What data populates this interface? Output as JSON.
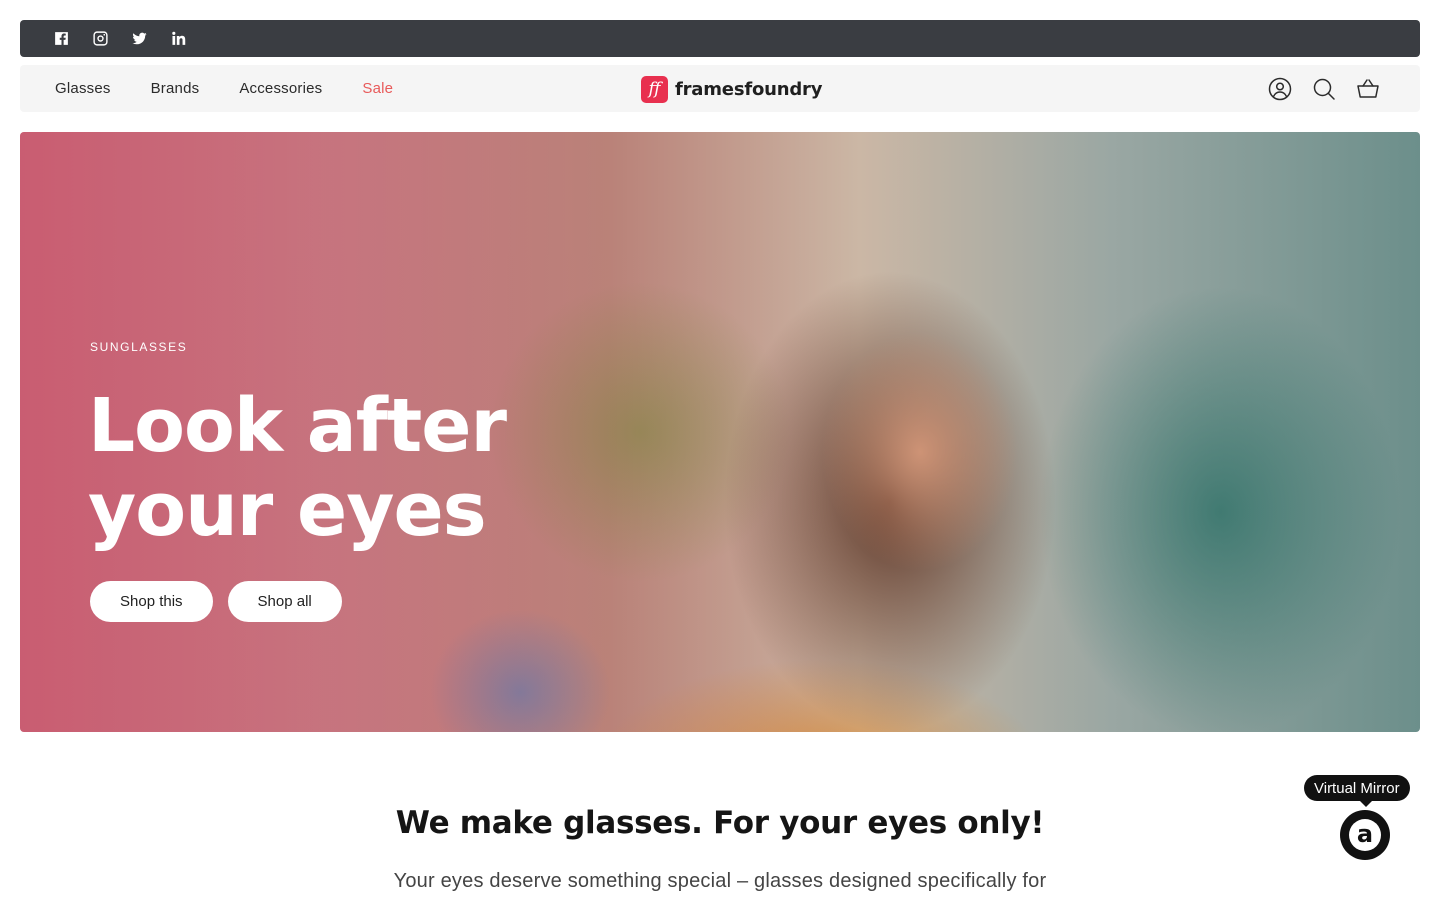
{
  "social": {
    "icons": [
      "facebook-icon",
      "instagram-icon",
      "twitter-icon",
      "linkedin-icon"
    ]
  },
  "nav": {
    "links": [
      {
        "label": "Glasses"
      },
      {
        "label": "Brands"
      },
      {
        "label": "Accessories"
      },
      {
        "label": "Sale",
        "color": "#e85a5a"
      }
    ],
    "logo": {
      "mark": "ff",
      "text": "framesfoundry",
      "mark_color": "#e8304f"
    },
    "icons": [
      "account-icon",
      "search-icon",
      "cart-icon"
    ]
  },
  "hero": {
    "label": "SUNGLASSES",
    "title_line1": "Look after",
    "title_line2": "your eyes",
    "buttons": {
      "primary": "Shop this",
      "secondary": "Shop all"
    }
  },
  "intro": {
    "title": "We make glasses. For your eyes only!",
    "subtitle": "Your eyes deserve something special – glasses designed specifically for"
  },
  "virtual_mirror": {
    "tooltip": "Virtual Mirror",
    "glyph": "a"
  }
}
